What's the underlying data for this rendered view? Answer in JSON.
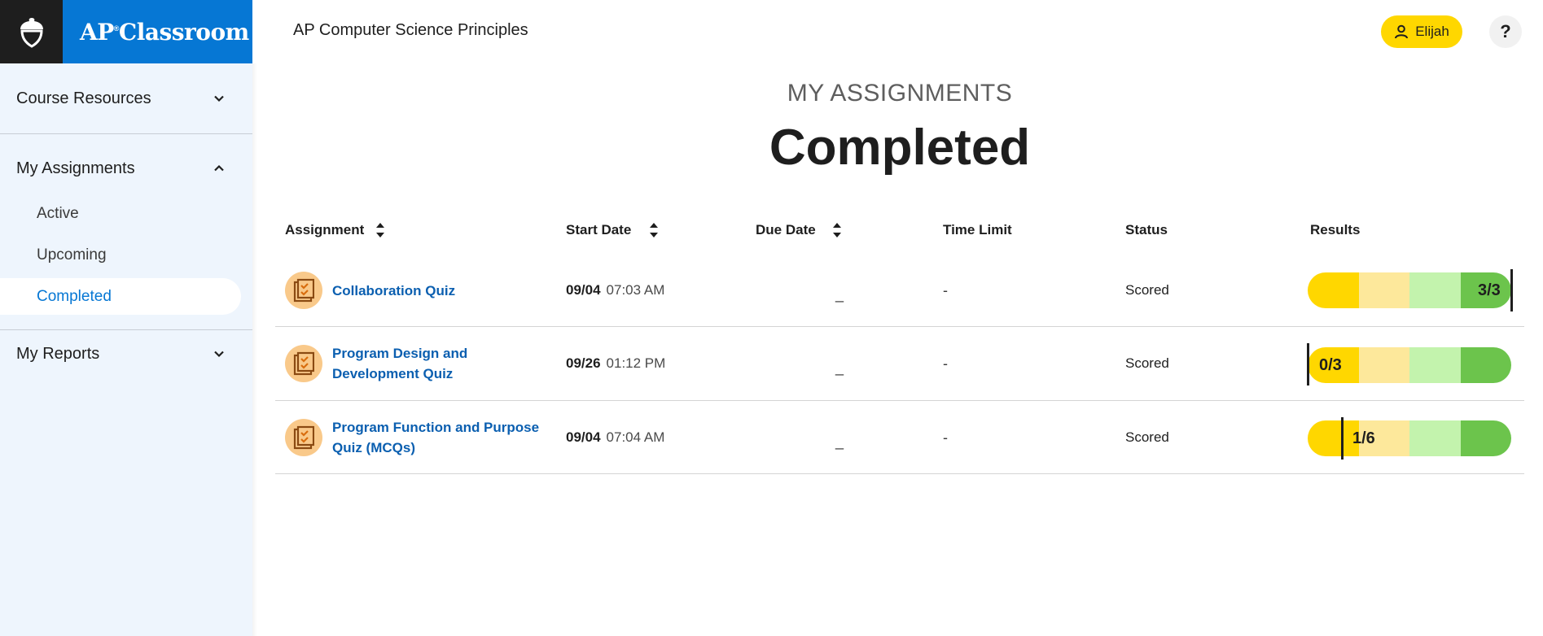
{
  "brand": {
    "name": "AP",
    "name_suffix": "Classroom",
    "reg_mark": "®"
  },
  "course_title": "AP Computer Science Principles",
  "user": {
    "name": "Elijah"
  },
  "help_label": "?",
  "sidebar": {
    "sections": [
      {
        "label": "Course Resources",
        "expanded": false
      },
      {
        "label": "My Assignments",
        "expanded": true,
        "items": [
          {
            "label": "Active"
          },
          {
            "label": "Upcoming"
          },
          {
            "label": "Completed",
            "selected": true
          }
        ]
      },
      {
        "label": "My Reports",
        "expanded": false
      }
    ]
  },
  "page": {
    "kicker": "MY ASSIGNMENTS",
    "title": "Completed"
  },
  "table": {
    "headers": {
      "assignment": "Assignment",
      "start_date": "Start Date",
      "due_date": "Due Date",
      "time_limit": "Time Limit",
      "status": "Status",
      "results": "Results"
    },
    "rows": [
      {
        "name": "Collaboration Quiz",
        "start_day": "09/04",
        "start_time": "07:03 AM",
        "due": "_",
        "time_limit": "-",
        "status": "Scored",
        "score": "3/3",
        "score_fraction": 1.0
      },
      {
        "name": "Program Design and Development Quiz",
        "start_day": "09/26",
        "start_time": "01:12 PM",
        "due": "_",
        "time_limit": "-",
        "status": "Scored",
        "score": "0/3",
        "score_fraction": 0.0
      },
      {
        "name": "Program Function and Purpose Quiz (MCQs)",
        "start_day": "09/04",
        "start_time": "07:04 AM",
        "due": "_",
        "time_limit": "-",
        "status": "Scored",
        "score": "1/6",
        "score_fraction": 0.1667
      }
    ]
  },
  "colors": {
    "brand_blue": "#0677d4",
    "sidebar_bg": "#eef5fd",
    "link_blue": "#0b5fb0",
    "accent_yellow": "#ffd700",
    "result_segments": [
      "#ffd700",
      "#fde89b",
      "#c3f3ad",
      "#6cc44c"
    ]
  }
}
